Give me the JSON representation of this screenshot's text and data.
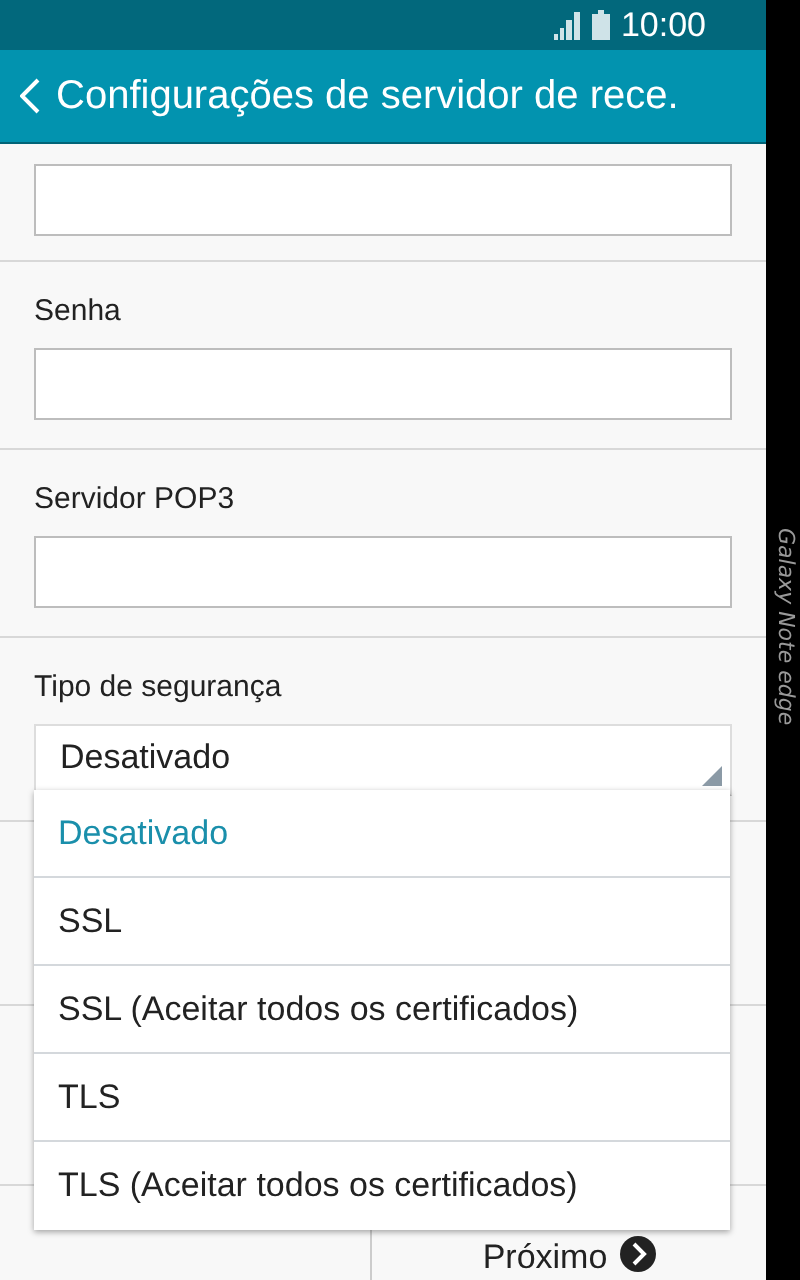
{
  "status_bar": {
    "time": "10:00"
  },
  "header": {
    "title": "Configurações de servidor de rece."
  },
  "fields": [
    {
      "kind": "input"
    },
    {
      "kind": "input",
      "label": "Senha"
    },
    {
      "kind": "input",
      "label": "Servidor POP3"
    }
  ],
  "security": {
    "label": "Tipo de segurança",
    "value": "Desativado",
    "expanded": true,
    "options": [
      {
        "label": "Desativado",
        "selected": true
      },
      {
        "label": "SSL",
        "selected": false
      },
      {
        "label": "SSL (Aceitar todos os certificados)",
        "selected": false
      },
      {
        "label": "TLS",
        "selected": false
      },
      {
        "label": "TLS (Aceitar todos os certificados)",
        "selected": false
      }
    ]
  },
  "footer": {
    "next_button": "Próximo"
  },
  "edge_screen": {
    "text": "Galaxy Note edge"
  }
}
